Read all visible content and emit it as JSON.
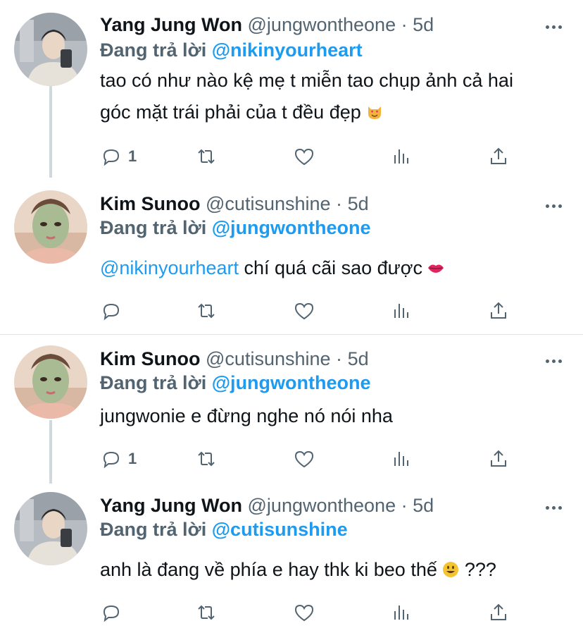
{
  "tweets": [
    {
      "name": "Yang Jung Won",
      "handle": "@jungwontheone",
      "dot": "·",
      "time": "5d",
      "replying_prefix": "Đang trả lời",
      "replying_to": "@nikinyourheart",
      "text_line1": "tao có như nào kệ mẹ t miễn tao chụp ảnh cả hai",
      "text_line2": "góc mặt trái phải của t đều đẹp",
      "emoji": "heart-eyes-cat",
      "reply_count": "1",
      "avatar_colors": [
        "#8a8f96",
        "#d8d2ca"
      ]
    },
    {
      "name": "Kim Sunoo",
      "handle": "@cutisunshine",
      "dot": "·",
      "time": "5d",
      "replying_prefix": "Đang trả lời",
      "replying_to": "@jungwontheone",
      "mention": "@nikinyourheart",
      "text": "chí quá cãi sao được",
      "emoji": "lips",
      "reply_count": "",
      "avatar_colors": [
        "#c7a48e",
        "#9fb28a"
      ]
    },
    {
      "name": "Kim Sunoo",
      "handle": "@cutisunshine",
      "dot": "·",
      "time": "5d",
      "replying_prefix": "Đang trả lời",
      "replying_to": "@jungwontheone",
      "text": "jungwonie e đừng nghe nó nói nha",
      "reply_count": "1",
      "avatar_colors": [
        "#c7a48e",
        "#9fb28a"
      ]
    },
    {
      "name": "Yang Jung Won",
      "handle": "@jungwontheone",
      "dot": "·",
      "time": "5d",
      "replying_prefix": "Đang trả lời",
      "replying_to": "@cutisunshine",
      "text": "anh là đang về phía e hay thk ki beo thế",
      "emoji": "smiley",
      "text_suffix": "???",
      "reply_count": "",
      "avatar_colors": [
        "#8a8f96",
        "#d8d2ca"
      ]
    }
  ],
  "colors": {
    "accent": "#1d9bf0",
    "muted": "#536471",
    "text": "#0f1419",
    "divider": "#dfe3e6"
  }
}
